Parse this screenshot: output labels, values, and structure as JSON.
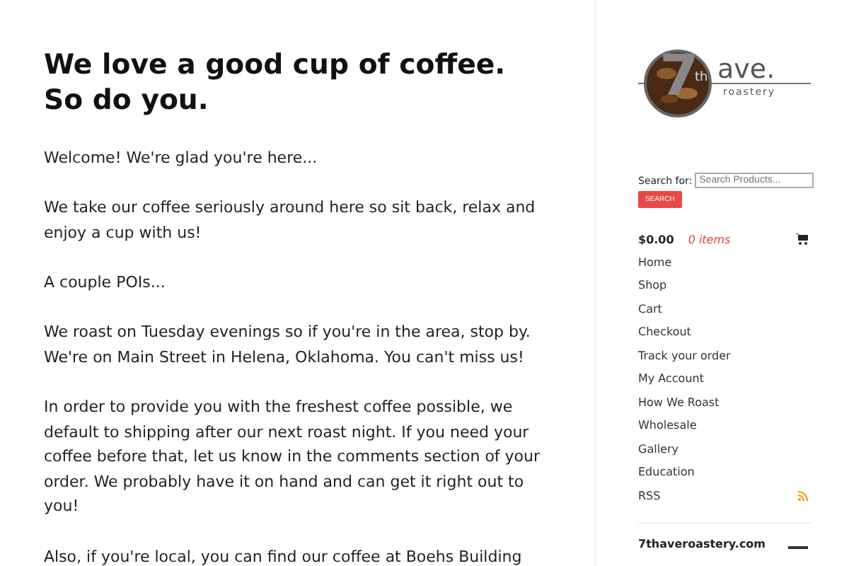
{
  "main": {
    "title": "We love a good cup of coffee. So do you.",
    "paragraphs": [
      "Welcome! We're glad you're here...",
      "We take our coffee seriously around here so sit back, relax and enjoy a cup with us!",
      "A couple POIs...",
      "We roast on Tuesday evenings so if you're in the area, stop by. We're on Main Street in Helena, Oklahoma. You can't miss us!",
      "In order to provide you with the freshest coffee possible, we default to shipping after our next roast night. If you need your coffee before that, let us know in the comments section of your order. We probably have it on hand and can get it right out to you!",
      "Also, if you're local, you can find our coffee at Boehs Building"
    ]
  },
  "sidebar": {
    "logo": {
      "numeral": "7",
      "suffix": "th",
      "word": "ave.",
      "tagline": "roastery"
    },
    "search": {
      "label": "Search for:",
      "placeholder": "Search Products...",
      "button": "SEARCH"
    },
    "cart": {
      "total": "$0.00",
      "items": "0 items"
    },
    "menu": [
      {
        "label": "Home",
        "kind": "link"
      },
      {
        "label": "Shop",
        "kind": "link"
      },
      {
        "label": "Cart",
        "kind": "link"
      },
      {
        "label": "Checkout",
        "kind": "link"
      },
      {
        "label": "Track your order",
        "kind": "link"
      },
      {
        "label": "My Account",
        "kind": "link"
      },
      {
        "label": "How We Roast",
        "kind": "link"
      },
      {
        "label": "Wholesale",
        "kind": "link"
      },
      {
        "label": "Gallery",
        "kind": "link"
      },
      {
        "label": "Education",
        "kind": "link"
      },
      {
        "label": "RSS",
        "kind": "rss"
      }
    ],
    "footer_title": "7thaveroastery.com"
  }
}
